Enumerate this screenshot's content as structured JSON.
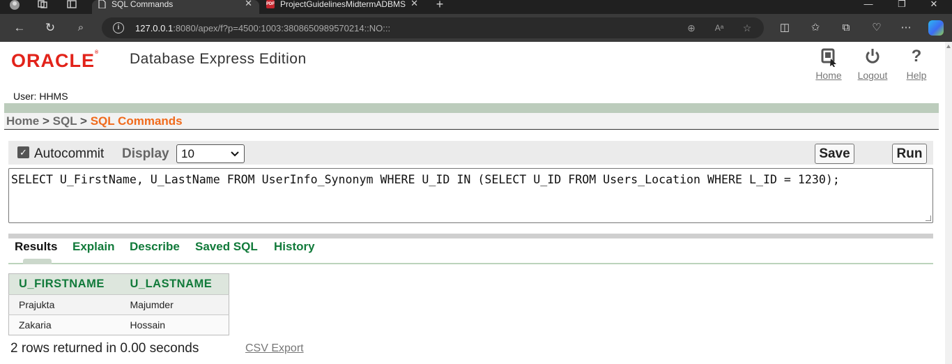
{
  "browser": {
    "tabs": [
      {
        "title": "SQL Commands",
        "active": true
      },
      {
        "title": "ProjectGuidelinesMidtermADBMS",
        "active": false,
        "icon": "PDF"
      }
    ],
    "tab_close": "✕",
    "new_tab": "+",
    "url_host": "127.0.0.1",
    "url_rest": ":8080/apex/f?p=4500:1003:3808650989570214::NO:::"
  },
  "header": {
    "logo_text": "ORACLE",
    "product_name": "Database Express Edition",
    "user_line": "User: HHMS",
    "links": [
      {
        "label": "Home",
        "icon": "home-icon"
      },
      {
        "label": "Logout",
        "icon": "power-icon"
      },
      {
        "label": "Help",
        "icon": "help-icon"
      }
    ]
  },
  "breadcrumb": {
    "items": [
      "Home",
      "SQL"
    ],
    "separator": ">",
    "current": "SQL Commands"
  },
  "toolbar": {
    "autocommit_label": "Autocommit",
    "autocommit_checked": true,
    "display_label": "Display",
    "display_value": "10",
    "save_label": "Save",
    "run_label": "Run"
  },
  "editor": {
    "sql": "SELECT U_FirstName, U_LastName FROM UserInfo_Synonym WHERE U_ID IN (SELECT U_ID FROM Users_Location WHERE L_ID = 1230);"
  },
  "subtabs": [
    {
      "label": "Results",
      "active": true
    },
    {
      "label": "Explain",
      "active": false
    },
    {
      "label": "Describe",
      "active": false
    },
    {
      "label": "Saved SQL",
      "active": false
    },
    {
      "label": "History",
      "active": false
    }
  ],
  "results": {
    "columns": [
      "U_FIRSTNAME",
      "U_LASTNAME"
    ],
    "rows": [
      [
        "Prajukta",
        "Majumder"
      ],
      [
        "Zakaria",
        "Hossain"
      ]
    ],
    "message": "2 rows returned in 0.00 seconds",
    "csv_label": "CSV Export"
  },
  "colors": {
    "oracle_red": "#e2231a",
    "breadcrumb_current": "#f06a1b",
    "tab_green": "#117a3a"
  }
}
